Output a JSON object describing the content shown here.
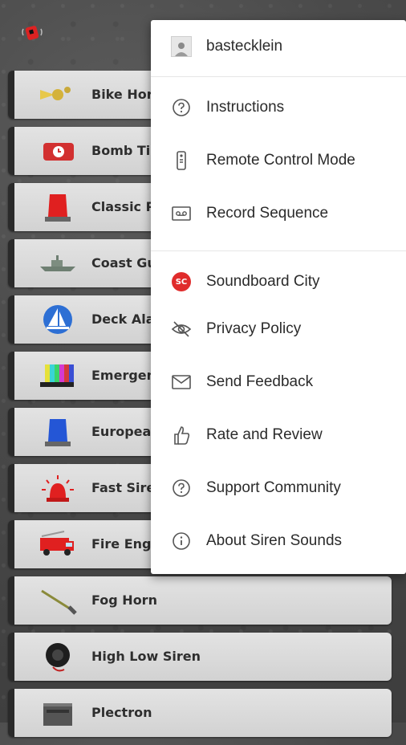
{
  "menu": {
    "account": {
      "username": "bastecklein",
      "icon": "avatar"
    },
    "items": [
      {
        "label": "Instructions",
        "icon": "help-circle-icon"
      },
      {
        "label": "Remote Control Mode",
        "icon": "remote-icon"
      },
      {
        "label": "Record Sequence",
        "icon": "cassette-icon"
      },
      {
        "label": "Soundboard City",
        "icon": "sc-logo",
        "badge": "SC"
      },
      {
        "label": "Privacy Policy",
        "icon": "eye-off-icon"
      },
      {
        "label": "Send Feedback",
        "icon": "mail-icon"
      },
      {
        "label": "Rate and Review",
        "icon": "thumbs-up-icon"
      },
      {
        "label": "Support Community",
        "icon": "help-circle-icon"
      },
      {
        "label": "About Siren Sounds",
        "icon": "info-icon"
      }
    ]
  },
  "sounds": [
    {
      "label": "Bike Horn",
      "icon": "bike-horn-icon"
    },
    {
      "label": "Bomb Time",
      "icon": "bomb-timer-icon"
    },
    {
      "label": "Classic Pol",
      "icon": "police-light-icon"
    },
    {
      "label": "Coast Guar",
      "icon": "ship-icon"
    },
    {
      "label": "Deck Alarm",
      "icon": "sailboat-icon"
    },
    {
      "label": "Emergency",
      "icon": "test-pattern-icon"
    },
    {
      "label": "European S",
      "icon": "blue-light-icon"
    },
    {
      "label": "Fast Siren",
      "icon": "red-siren-icon"
    },
    {
      "label": "Fire Engine",
      "icon": "fire-truck-icon"
    },
    {
      "label": "Fog Horn",
      "icon": "fog-horn-icon"
    },
    {
      "label": "High Low Siren",
      "icon": "speaker-siren-icon"
    },
    {
      "label": "Plectron",
      "icon": "radio-icon"
    }
  ],
  "colors": {
    "accent": "#e02c2c",
    "menu_bg": "#ffffff",
    "row_bg": "#dcdcdc"
  }
}
